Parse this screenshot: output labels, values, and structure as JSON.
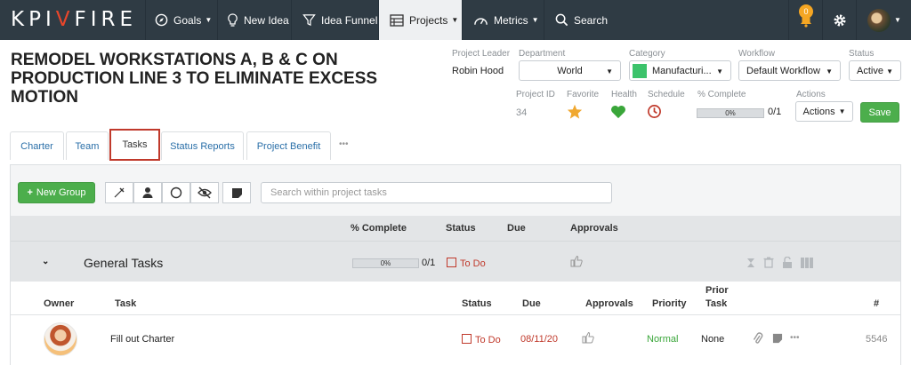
{
  "nav": {
    "logo_left": "KPI",
    "logo_right": "FIRE",
    "items": [
      {
        "label": "Goals",
        "icon": "compass-icon"
      },
      {
        "label": "New Idea",
        "icon": "lightbulb-icon"
      },
      {
        "label": "Idea Funnel",
        "icon": "funnel-icon"
      },
      {
        "label": "Projects",
        "icon": "projects-icon"
      },
      {
        "label": "Metrics",
        "icon": "gauge-icon"
      },
      {
        "label": "Search",
        "icon": "search-icon"
      }
    ],
    "notification_count": "0"
  },
  "project": {
    "title": "REMODEL WORKSTATIONS A, B & C ON PRODUCTION LINE 3 TO ELIMINATE EXCESS MOTION",
    "leader_label": "Project Leader",
    "leader": "Robin Hood",
    "department_label": "Department",
    "department": "World",
    "category_label": "Category",
    "category": "Manufacturi...",
    "category_color": "#3cc36b",
    "workflow_label": "Workflow",
    "workflow": "Default Workflow",
    "status_label": "Status",
    "status": "Active",
    "id_label": "Project ID",
    "id": "34",
    "favorite_label": "Favorite",
    "health_label": "Health",
    "schedule_label": "Schedule",
    "complete_label": "% Complete",
    "complete_pct": "0%",
    "complete_count": "0/1",
    "actions_label": "Actions",
    "actions_button": "Actions",
    "save_button": "Save"
  },
  "tabs": [
    "Charter",
    "Team",
    "Tasks",
    "Status Reports",
    "Project Benefit"
  ],
  "tabs_more": "•••",
  "toolbar": {
    "new_group": "New Group",
    "search_placeholder": "Search within project tasks"
  },
  "group_header": {
    "complete": "% Complete",
    "status": "Status",
    "due": "Due",
    "approvals": "Approvals"
  },
  "group": {
    "name": "General Tasks",
    "progress_pct": "0%",
    "progress_count": "0/1",
    "status": "To Do"
  },
  "task_header": {
    "owner": "Owner",
    "task": "Task",
    "status": "Status",
    "due": "Due",
    "approvals": "Approvals",
    "priority": "Priority",
    "prior_task_1": "Prior",
    "prior_task_2": "Task",
    "number": "#"
  },
  "tasks": [
    {
      "task": "Fill out Charter",
      "status": "To Do",
      "due": "08/11/20",
      "priority": "Normal",
      "prior_task": "None",
      "number": "5546"
    }
  ]
}
